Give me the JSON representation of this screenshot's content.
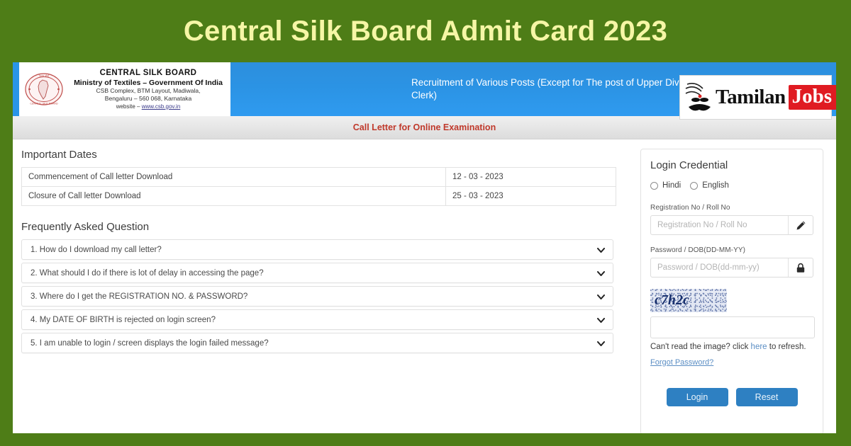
{
  "banner": {
    "title": "Central Silk Board Admit Card 2023",
    "bg_color": "#4e7d17",
    "text_color": "#f6f6a6"
  },
  "site_header": {
    "org_name": "CENTRAL SILK BOARD",
    "org_ministry": "Ministry of Textiles – Government Of India",
    "org_address_line1": "CSB Complex, BTM Layout, Madiwala,",
    "org_address_line2": "Bengaluru – 560 068, Karnataka",
    "org_website_prefix": "website – ",
    "org_website": "www.csb.gov.in",
    "recruitment_text": "Recruitment of Various Posts (Except for The post of Upper Division Clerk)",
    "emblem_icon": "central-silk-board-emblem",
    "blue_color": "#2b93e4"
  },
  "watermark": {
    "brand_primary": "Tamilan",
    "brand_secondary": "Jobs",
    "face_icon": "tamilan-face-icon",
    "badge_color": "#e01b22"
  },
  "call_strip": {
    "text": "Call Letter for Online Examination",
    "color": "#c0392b"
  },
  "important_dates": {
    "heading": "Important Dates",
    "rows": [
      {
        "label": "Commencement of Call letter Download",
        "value": "12 - 03 - 2023"
      },
      {
        "label": "Closure of Call letter Download",
        "value": "25 - 03 - 2023"
      }
    ]
  },
  "faq": {
    "heading": "Frequently Asked Question",
    "chevron_icon": "chevron-down-icon",
    "chevron_glyph": "⌄",
    "items": [
      {
        "text": "1. How do I download my call letter?"
      },
      {
        "text": "2. What should I do if there is lot of delay in accessing the page?"
      },
      {
        "text": "3. Where do I get the REGISTRATION NO. & PASSWORD?"
      },
      {
        "text": "4. My DATE OF BIRTH is rejected on login screen?"
      },
      {
        "text": "5. I am unable to login / screen displays the login failed message?"
      }
    ]
  },
  "login": {
    "title": "Login Credential",
    "language_options": [
      {
        "label": "Hindi",
        "selected": false
      },
      {
        "label": "English",
        "selected": false
      }
    ],
    "registration": {
      "label": "Registration No / Roll No",
      "placeholder": "Registration No / Roll No",
      "value": "",
      "adorn_icon": "pencil-icon"
    },
    "password": {
      "label": "Password / DOB(DD-MM-YY)",
      "placeholder": "Password / DOB(dd-mm-yy)",
      "value": "",
      "adorn_icon": "lock-icon"
    },
    "captcha": {
      "text": "c7h2c",
      "input_value": "",
      "refresh_prefix": "Can't read the image? click ",
      "refresh_link": "here",
      "refresh_suffix": " to refresh."
    },
    "forgot_password": "Forgot Password?",
    "buttons": {
      "login": "Login",
      "reset": "Reset",
      "color": "#2e80c2"
    }
  }
}
